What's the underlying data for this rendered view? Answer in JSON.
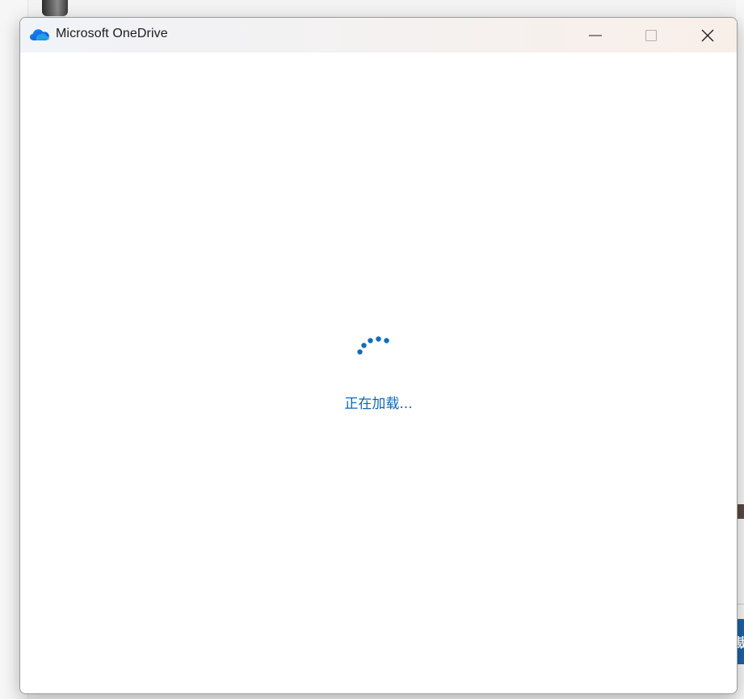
{
  "window": {
    "title": "Microsoft OneDrive",
    "icon": "onedrive-cloud-icon"
  },
  "titlebar_buttons": {
    "minimize": "minimize-icon",
    "maximize": "maximize-icon",
    "close": "close-icon"
  },
  "content": {
    "loading_text": "正在加载...",
    "spinner": "loading-spinner"
  },
  "colors": {
    "accent": "#0f65b1",
    "spinner": "#0f6cbd"
  }
}
